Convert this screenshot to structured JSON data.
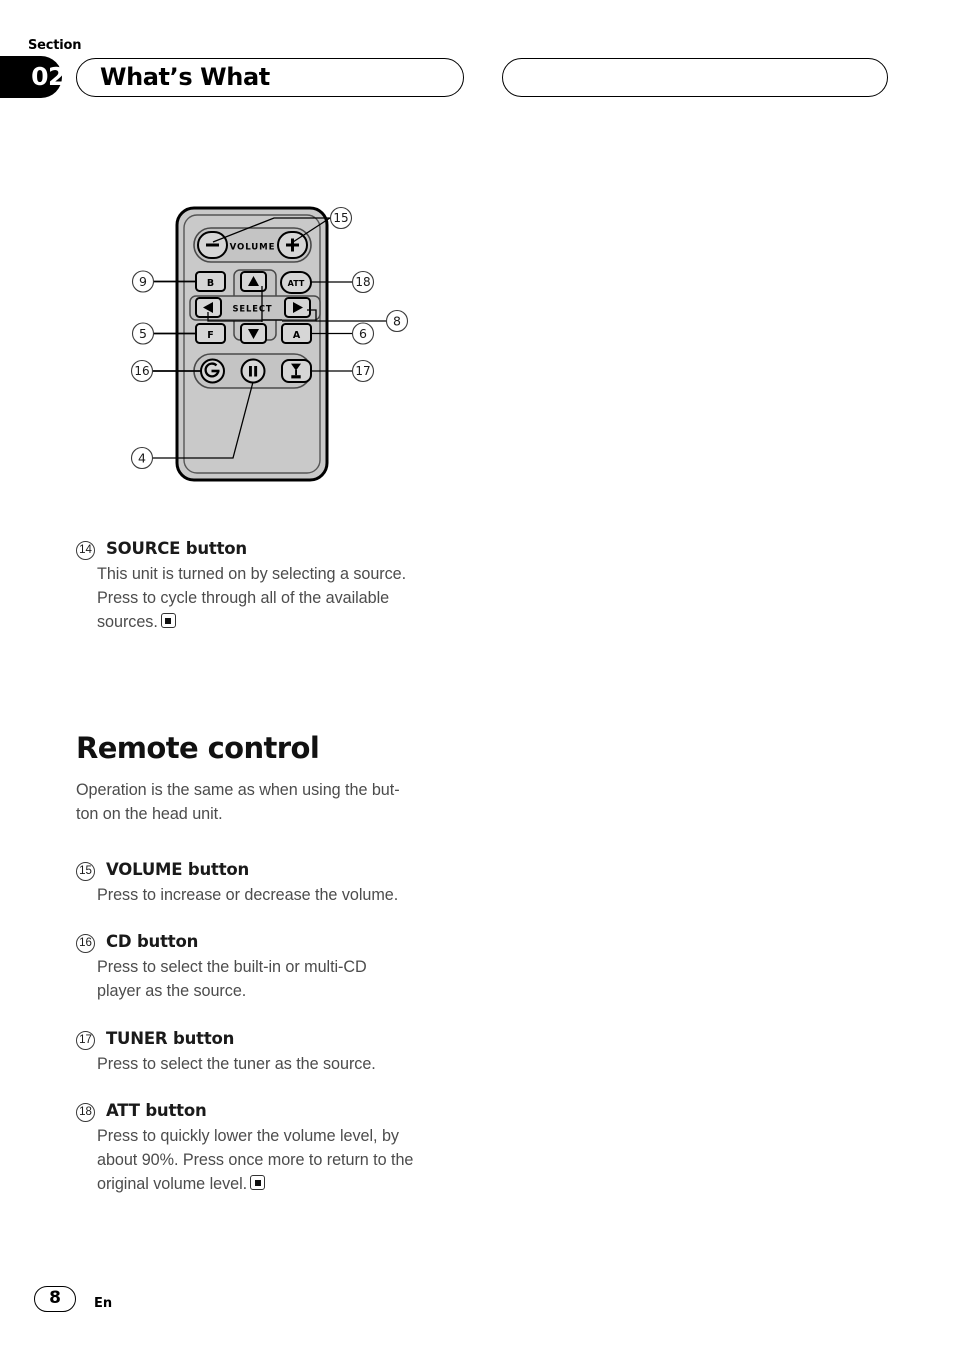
{
  "header": {
    "section_label": "Section",
    "section_number": "02",
    "title": "What’s What",
    "right_pill_text": ""
  },
  "figure": {
    "name": "remote-control-diagram",
    "device_labels": {
      "volume": "VOLUME",
      "select": "SELECT",
      "att": "ATT",
      "band": "B",
      "function": "F",
      "audio": "A"
    },
    "callouts": [
      {
        "id": "9",
        "side": "left",
        "target": "band-button"
      },
      {
        "id": "5",
        "side": "left",
        "target": "function-button"
      },
      {
        "id": "16",
        "side": "left",
        "target": "cd-button"
      },
      {
        "id": "4",
        "side": "left",
        "target": "pause-button"
      },
      {
        "id": "15",
        "side": "right",
        "target": "volume-buttons"
      },
      {
        "id": "18",
        "side": "right",
        "target": "att-button"
      },
      {
        "id": "8",
        "side": "right",
        "target": "select-arrow-buttons"
      },
      {
        "id": "6",
        "side": "right",
        "target": "audio-button"
      },
      {
        "id": "17",
        "side": "right",
        "target": "tuner-button"
      }
    ]
  },
  "content": {
    "source": {
      "callout": "14",
      "title": "SOURCE button",
      "lines": [
        "This unit is turned on by selecting a source.",
        "Press to cycle through all of the available",
        "sources."
      ],
      "end_mark": "square-bullet"
    },
    "remote_heading": "Remote control",
    "remote_intro": [
      "Operation is the same as when using the but-",
      "ton on the head unit."
    ],
    "volume": {
      "callout": "15",
      "title": "VOLUME button",
      "lines": [
        "Press to increase or decrease the volume."
      ]
    },
    "cd": {
      "callout": "16",
      "title": "CD button",
      "lines": [
        "Press to select the built-in or multi-CD",
        "player as the source."
      ]
    },
    "tuner": {
      "callout": "17",
      "title": "TUNER button",
      "lines": [
        "Press to select the tuner as the source."
      ]
    },
    "att": {
      "callout": "18",
      "title": "ATT button",
      "lines": [
        "Press to quickly lower the volume level, by",
        "about 90%. Press once more to return to the",
        "original volume level."
      ],
      "end_mark": "square-bullet"
    }
  },
  "footer": {
    "page_number": "8",
    "language": "En"
  }
}
